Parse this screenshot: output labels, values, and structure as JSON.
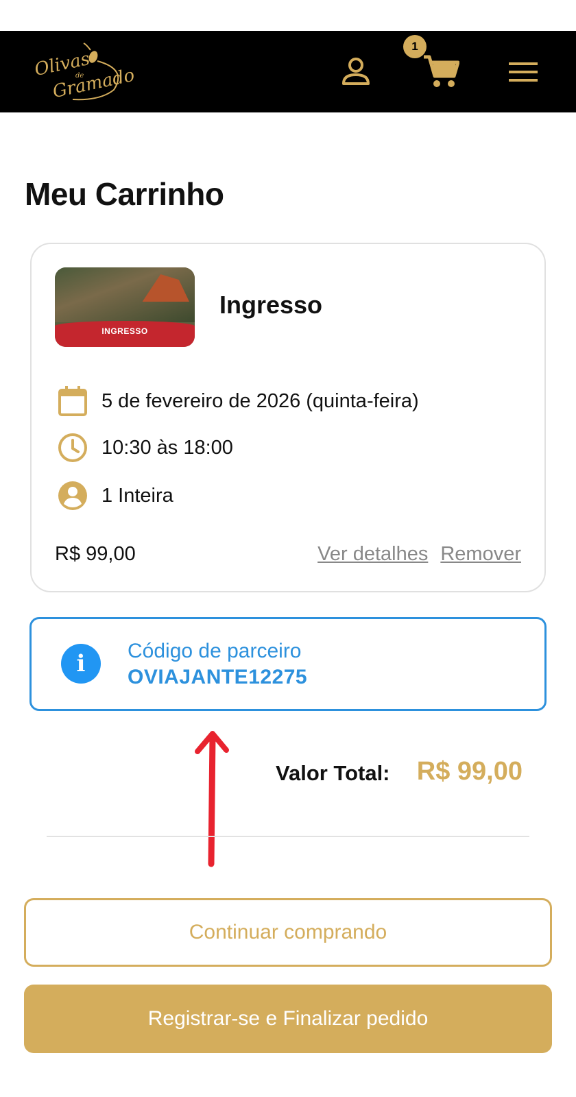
{
  "header": {
    "logo": {
      "line1": "Olivas",
      "de": "de",
      "line2": "Gramado"
    },
    "icons": {
      "user": "user-icon",
      "cart": "cart-icon",
      "menu": "menu-icon"
    },
    "cart_count": "1"
  },
  "page_title": "Meu Carrinho",
  "cart_item": {
    "thumbnail_label": "INGRESSO",
    "title": "Ingresso",
    "date": "5 de fevereiro de 2026 (quinta-feira)",
    "time": "10:30 às 18:00",
    "quantity": "1 Inteira",
    "price": "R$ 99,00",
    "details_link": "Ver detalhes",
    "remove_link": "Remover",
    "icons": {
      "date": "calendar-icon",
      "time": "clock-icon",
      "quantity": "person-icon"
    }
  },
  "partner": {
    "icon": "info-icon",
    "icon_glyph": "i",
    "label": "Código de parceiro",
    "code": "OVIAJANTE12275"
  },
  "total": {
    "label": "Valor Total:",
    "value": "R$ 99,00"
  },
  "buttons": {
    "continue": "Continuar comprando",
    "checkout": "Registrar-se e Finalizar pedido"
  },
  "colors": {
    "gold": "#d4ad5c",
    "header_bg": "#000000",
    "partner_blue": "#2d91dd",
    "annotation_red": "#e8232f"
  }
}
